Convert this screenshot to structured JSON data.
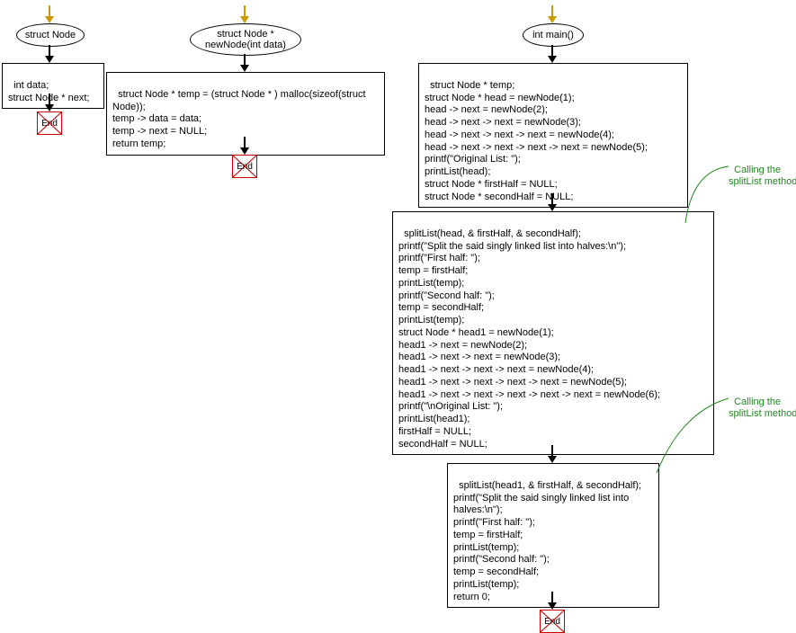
{
  "flow1": {
    "start": "struct Node",
    "box1": "int data;\nstruct Node * next;",
    "end": "End"
  },
  "flow2": {
    "start": "struct Node *\nnewNode(int data)",
    "box1": "struct Node * temp = (struct Node * ) malloc(sizeof(struct\nNode));\ntemp -> data = data;\ntemp -> next = NULL;\nreturn temp;",
    "end": "End"
  },
  "flow3": {
    "start": "int main()",
    "box1": "struct Node * temp;\nstruct Node * head = newNode(1);\nhead -> next = newNode(2);\nhead -> next -> next = newNode(3);\nhead -> next -> next -> next = newNode(4);\nhead -> next -> next -> next -> next = newNode(5);\nprintf(\"Original List: \");\nprintList(head);\nstruct Node * firstHalf = NULL;\nstruct Node * secondHalf = NULL;",
    "box2": "splitList(head, & firstHalf, & secondHalf);\nprintf(\"Split the said singly linked list into halves:\\n\");\nprintf(\"First half: \");\ntemp = firstHalf;\nprintList(temp);\nprintf(\"Second half: \");\ntemp = secondHalf;\nprintList(temp);\nstruct Node * head1 = newNode(1);\nhead1 -> next = newNode(2);\nhead1 -> next -> next = newNode(3);\nhead1 -> next -> next -> next = newNode(4);\nhead1 -> next -> next -> next -> next = newNode(5);\nhead1 -> next -> next -> next -> next -> next = newNode(6);\nprintf(\"\\nOriginal List: \");\nprintList(head1);\nfirstHalf = NULL;\nsecondHalf = NULL;",
    "box3": "splitList(head1, & firstHalf, & secondHalf);\nprintf(\"Split the said singly linked list into\nhalves:\\n\");\nprintf(\"First half: \");\ntemp = firstHalf;\nprintList(temp);\nprintf(\"Second half: \");\ntemp = secondHalf;\nprintList(temp);\nreturn 0;",
    "end": "End"
  },
  "annotations": {
    "a1": "Calling the\nsplitList method",
    "a2": "Calling the\nsplitList method"
  }
}
